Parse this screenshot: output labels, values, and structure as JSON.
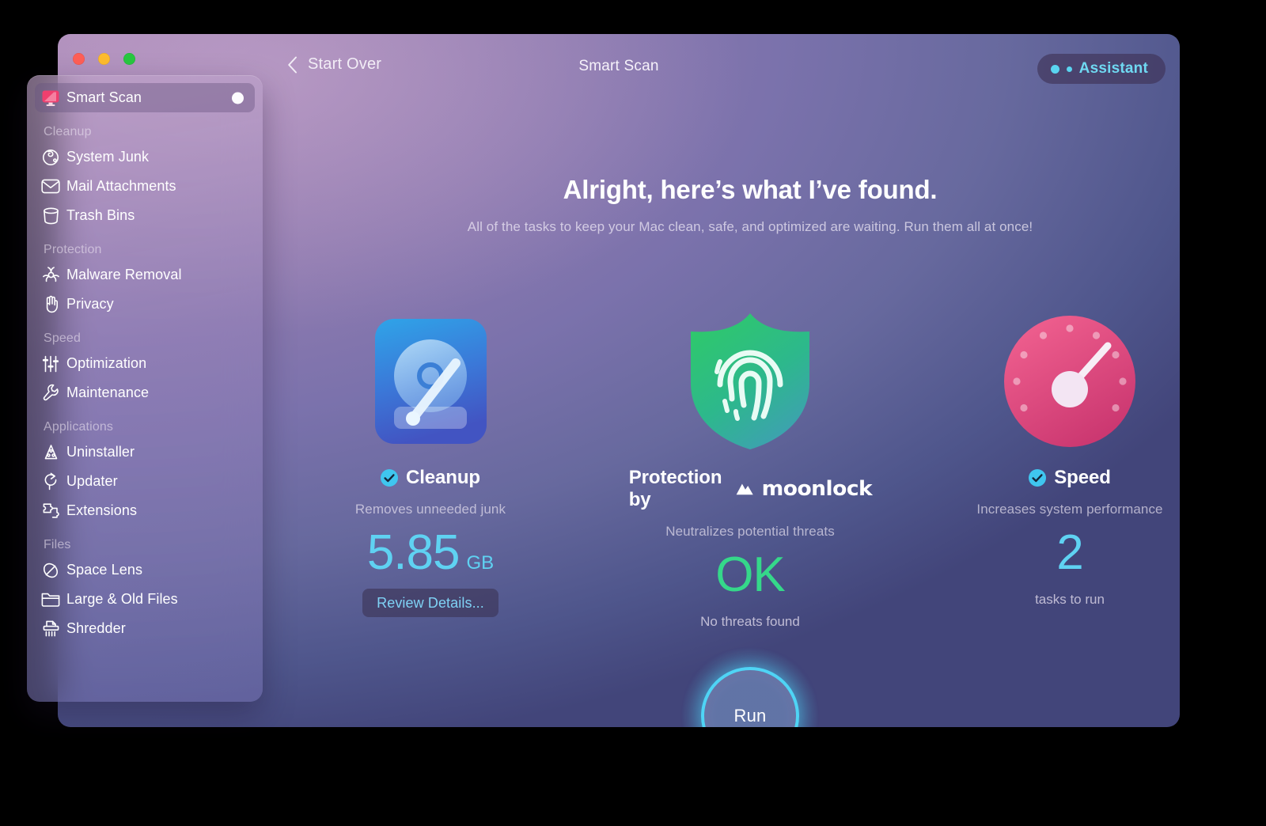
{
  "window": {
    "title": "Smart Scan",
    "back_label": "Start Over",
    "traffic_lights": [
      "close-button",
      "minimize-button",
      "zoom-button"
    ],
    "assistant": {
      "label": "Assistant",
      "accent": "#6fd9f2"
    }
  },
  "sidebar": {
    "selected": "Smart Scan",
    "top_item": {
      "label": "Smart Scan",
      "icon": "monitor-icon",
      "badge": "status-dot"
    },
    "groups": [
      {
        "title": "Cleanup",
        "items": [
          {
            "label": "System Junk",
            "icon": "junk-icon"
          },
          {
            "label": "Mail Attachments",
            "icon": "mail-icon"
          },
          {
            "label": "Trash Bins",
            "icon": "trash-icon"
          }
        ]
      },
      {
        "title": "Protection",
        "items": [
          {
            "label": "Malware Removal",
            "icon": "biohazard-icon"
          },
          {
            "label": "Privacy",
            "icon": "hand-icon"
          }
        ]
      },
      {
        "title": "Speed",
        "items": [
          {
            "label": "Optimization",
            "icon": "sliders-icon"
          },
          {
            "label": "Maintenance",
            "icon": "wrench-icon"
          }
        ]
      },
      {
        "title": "Applications",
        "items": [
          {
            "label": "Uninstaller",
            "icon": "uninstaller-icon"
          },
          {
            "label": "Updater",
            "icon": "refresh-icon"
          },
          {
            "label": "Extensions",
            "icon": "puzzle-icon"
          }
        ]
      },
      {
        "title": "Files",
        "items": [
          {
            "label": "Space Lens",
            "icon": "space-lens-icon"
          },
          {
            "label": "Large & Old Files",
            "icon": "folder-icon"
          },
          {
            "label": "Shredder",
            "icon": "shredder-icon"
          }
        ]
      }
    ]
  },
  "main": {
    "headline": "Alright, here’s what I’ve found.",
    "subhead": "All of the tasks to keep your Mac clean, safe, and optimized are waiting. Run them all at once!",
    "cards": [
      {
        "id": "cleanup",
        "art": "hard-drive-icon",
        "title": "Cleanup",
        "checked": true,
        "subtitle": "Removes unneeded junk",
        "value": "5.85",
        "unit": "GB",
        "value_color": "#5fd2f2",
        "action_label": "Review Details..."
      },
      {
        "id": "protection",
        "art": "shield-fingerprint-icon",
        "title": "Protection by",
        "brand": "moonlock",
        "checked": false,
        "subtitle": "Neutralizes potential threats",
        "value": "OK",
        "unit": "",
        "value_color": "#35d88a",
        "footnote": "No threats found"
      },
      {
        "id": "speed",
        "art": "speed-gauge-icon",
        "title": "Speed",
        "checked": true,
        "subtitle": "Increases system performance",
        "value": "2",
        "unit": "",
        "value_color": "#5fd2f2",
        "footnote": "tasks to run"
      }
    ],
    "run_button": {
      "label": "Run",
      "ring_color": "#4fd4f5"
    }
  }
}
